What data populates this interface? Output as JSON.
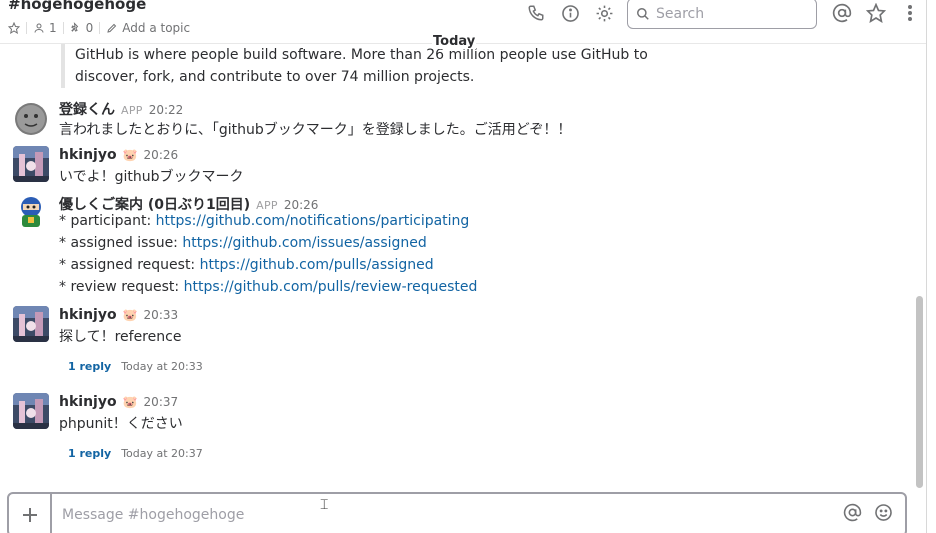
{
  "header": {
    "channel_name": "#hogehogehoge",
    "members_count": "1",
    "pinned_count": "0",
    "add_topic": "Add a topic",
    "search_placeholder": "Search"
  },
  "day_divider": "Today",
  "quote": {
    "line1": "GitHub is where people build software. More than 26 million people use GitHub to",
    "line2": "discover, fork, and contribute to over 74 million projects."
  },
  "messages": [
    {
      "sender": "登録くん",
      "tag": "APP",
      "time": "20:22",
      "lines": [
        "言われましたとおりに、「githubブックマーク」を登録しました。ご活用どぞ！！"
      ]
    },
    {
      "sender": "hkinjyo",
      "status_emoji": "🐷",
      "time": "20:26",
      "lines": [
        "いでよ！githubブックマーク"
      ]
    },
    {
      "sender": "優しくご案内 (0日ぶり1回目)",
      "tag": "APP",
      "time": "20:26",
      "items": [
        {
          "label": "* participant: ",
          "link": "https://github.com/notifications/participating"
        },
        {
          "label": "* assigned issue: ",
          "link": "https://github.com/issues/assigned"
        },
        {
          "label": "* assigned request: ",
          "link": "https://github.com/pulls/assigned"
        },
        {
          "label": "* review request: ",
          "link": "https://github.com/pulls/review-requested"
        }
      ]
    },
    {
      "sender": "hkinjyo",
      "status_emoji": "🐷",
      "time": "20:33",
      "lines": [
        "探して！reference"
      ],
      "reply_count": "1 reply",
      "reply_time": "Today at 20:33"
    },
    {
      "sender": "hkinjyo",
      "status_emoji": "🐷",
      "time": "20:37",
      "lines": [
        "phpunit！ください"
      ],
      "reply_count": "1 reply",
      "reply_time": "Today at 20:37"
    }
  ],
  "composer": {
    "placeholder": "Message #hogehogehoge"
  },
  "icons": [
    "star-icon",
    "member-icon",
    "pin-icon",
    "pencil-icon",
    "phone-icon",
    "info-icon",
    "gear-icon",
    "search-icon",
    "at-icon",
    "star-icon",
    "more-icon",
    "plus-icon",
    "emoji-icon"
  ],
  "colors": {
    "link": "#1264a3",
    "text": "#2c2d30",
    "muted": "#717274"
  }
}
